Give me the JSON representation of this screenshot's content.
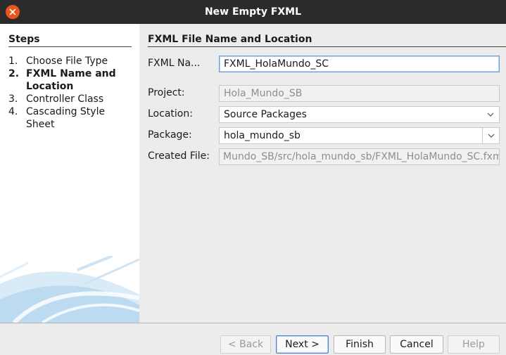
{
  "window": {
    "title": "New Empty FXML"
  },
  "steps": {
    "title": "Steps",
    "items": [
      {
        "num": "1.",
        "label": "Choose File Type"
      },
      {
        "num": "2.",
        "label": "FXML Name and Location"
      },
      {
        "num": "3.",
        "label": "Controller Class"
      },
      {
        "num": "4.",
        "label": "Cascading Style Sheet"
      }
    ],
    "current_index": 1
  },
  "content": {
    "title": "FXML File Name and Location",
    "fxml_name": {
      "label": "FXML Na...",
      "value": "FXML_HolaMundo_SC"
    },
    "project": {
      "label": "Project:",
      "value": "Hola_Mundo_SB"
    },
    "location": {
      "label": "Location:",
      "value": "Source Packages"
    },
    "package": {
      "label": "Package:",
      "value": "hola_mundo_sb"
    },
    "created_file": {
      "label": "Created File:",
      "value": "Mundo_SB/src/hola_mundo_sb/FXML_HolaMundo_SC.fxml"
    }
  },
  "buttons": {
    "back": "< Back",
    "next": "Next >",
    "finish": "Finish",
    "cancel": "Cancel",
    "help": "Help"
  },
  "colors": {
    "close_button": "#e9541f",
    "titlebar": "#2b2b2b",
    "focus_border": "#6aa0d8"
  }
}
